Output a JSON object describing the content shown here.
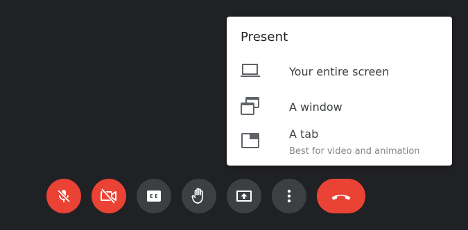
{
  "present_menu": {
    "title": "Present",
    "items": [
      {
        "icon": "laptop-icon",
        "label": "Your entire screen"
      },
      {
        "icon": "window-icon",
        "label": "A window"
      },
      {
        "icon": "tab-icon",
        "label": "A tab",
        "sublabel": "Best for video and animation"
      }
    ]
  },
  "controls": [
    {
      "icon": "mic-off-icon",
      "state": "muted",
      "color": "#ea4335"
    },
    {
      "icon": "camera-off-icon",
      "state": "off",
      "color": "#ea4335"
    },
    {
      "icon": "closed-captions-icon",
      "color": "#3c4043"
    },
    {
      "icon": "raise-hand-icon",
      "color": "#3c4043"
    },
    {
      "icon": "present-screen-icon",
      "color": "#3c4043"
    },
    {
      "icon": "more-options-icon",
      "color": "#3c4043"
    },
    {
      "icon": "leave-call-icon",
      "color": "#ea4335"
    }
  ],
  "colors": {
    "background": "#202124",
    "menu_background": "#ffffff",
    "accent_red": "#ea4335",
    "control_gray": "#3c4043"
  }
}
